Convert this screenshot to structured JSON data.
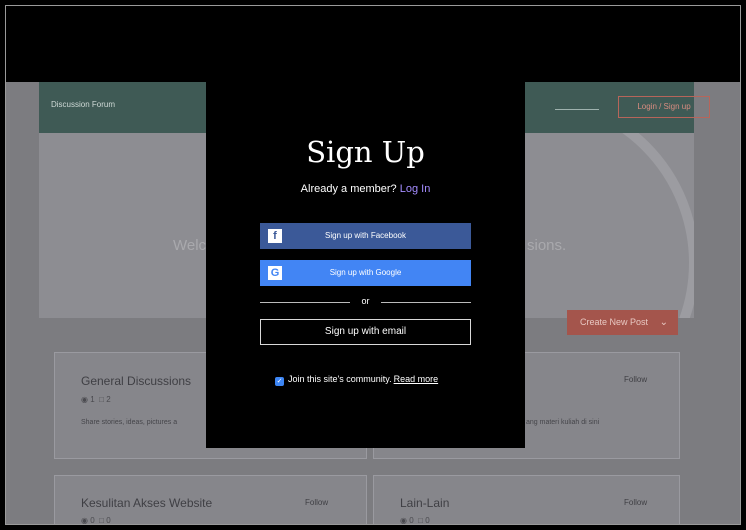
{
  "site": {
    "title": "Discussion Forum",
    "login_label": "Login / Sign up",
    "hero_left": "Welc",
    "hero_right": "sions.",
    "create_post_label": "Create New Post",
    "cards": [
      {
        "title": "General Discussions",
        "views": "1",
        "comments": "2",
        "desc": "Share stories, ideas, pictures a",
        "follow": ""
      },
      {
        "title": "",
        "views": "",
        "comments": "",
        "desc": "ang materi kuliah di sini",
        "follow": "Follow"
      },
      {
        "title": "Kesulitan Akses Website",
        "views": "0",
        "comments": "0",
        "desc": "",
        "follow": "Follow"
      },
      {
        "title": "Lain-Lain",
        "views": "0",
        "comments": "0",
        "desc": "",
        "follow": "Follow"
      }
    ]
  },
  "modal": {
    "title": "Sign Up",
    "already_member": "Already a member?",
    "login_link": "Log In",
    "facebook_label": "Sign up with Facebook",
    "google_label": "Sign up with Google",
    "or_label": "or",
    "email_label": "Sign up with email",
    "community_label": "Join this site's community.",
    "read_more": "Read more"
  },
  "icons": {
    "facebook": "facebook-icon",
    "google": "google-icon",
    "eye": "eye-icon",
    "comment": "comment-icon"
  },
  "colors": {
    "facebook": "#3b5998",
    "google": "#4285f4",
    "login_link": "#a48cff",
    "checkbox": "#3d86f5"
  }
}
